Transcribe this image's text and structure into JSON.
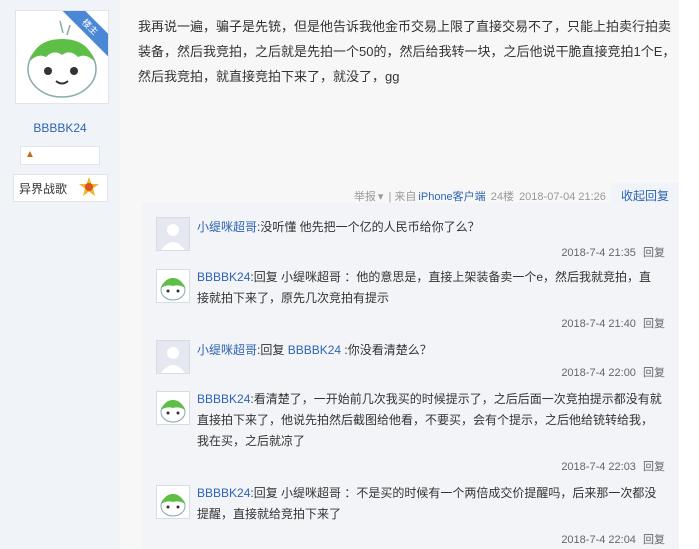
{
  "author": {
    "username": "BBBBK24",
    "corner_tag": "楼主",
    "badge_name": "异界战歌",
    "avatar": "green-slime-avatar"
  },
  "post": {
    "text": "我再说一遍，骗子是先铳，但是他告诉我他金币交易上限了直接交易不了，只能上拍卖行拍卖装备，然后我竞拍，之后就是先拍一个50的，然后给我转一块，之后他说干脆直接竞拍1个E，然后我竞拍，就直接竞拍下来了，就没了，gg"
  },
  "meta": {
    "report": "举报",
    "from": "| 来自",
    "client": "iPhone客户端",
    "floor": "24楼",
    "time": "2018-07-04 21:26",
    "collapse": "收起回复"
  },
  "replies": [
    {
      "name": "小缇咪超哥",
      "text": ":没听懂 他先把一个亿的人民币给你了么？",
      "time": "2018-7-4 21:35",
      "reply": "回复",
      "avatar": "blank"
    },
    {
      "name": "BBBBK24",
      "text": ":回复 小缇咪超哥 ：他的意思是，直接上架装备卖一个e，然后我就竞拍，直接就拍下来了，原先几次竞拍有提示",
      "time": "2018-7-4 21:40",
      "reply": "回复",
      "avatar": "slime"
    },
    {
      "name": "小缇咪超哥",
      "text": ":回复 ",
      "mention": "BBBBK24",
      "text2": " :你没看清楚么？",
      "time": "2018-7-4 22:00",
      "reply": "回复",
      "avatar": "blank"
    },
    {
      "name": "BBBBK24",
      "text": ":看清楚了，一开始前几次我买的时候提示了，之后后面一次竞拍提示都没有就直接拍下来了，他说先拍然后截图给他看，不要买，会有个提示，之后他给铳转给我，我在买，之后就凉了",
      "time": "2018-7-4 22:03",
      "reply": "回复",
      "avatar": "slime"
    },
    {
      "name": "BBBBK24",
      "text": ":回复 小缇咪超哥 ：不是买的时候有一个两倍成交价提醒吗，后来那一次都没提醒，直接就给竞拍下来了",
      "time": "2018-7-4 22:04",
      "reply": "回复",
      "avatar": "slime"
    }
  ]
}
